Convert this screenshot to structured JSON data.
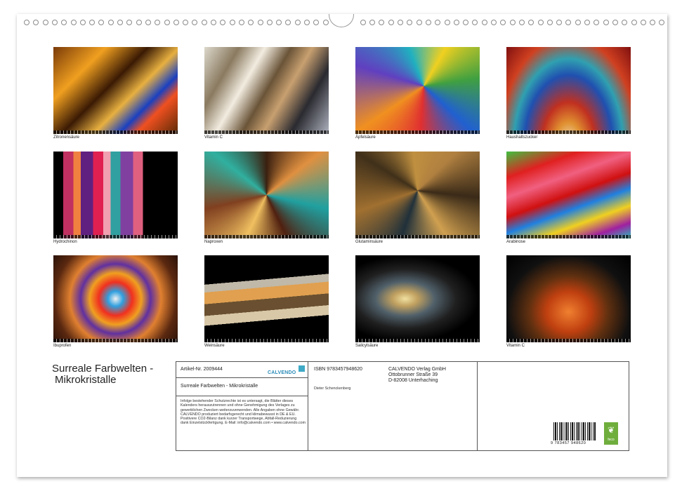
{
  "calendar": {
    "title_line1": "Surreale Farbwelten -",
    "title_line2": "Mikrokristalle"
  },
  "tiles": [
    {
      "caption": "Zitronensäure"
    },
    {
      "caption": "Vitamin C"
    },
    {
      "caption": "Äpfelsäure"
    },
    {
      "caption": "Haushaltszucker"
    },
    {
      "caption": "Hydrochinon"
    },
    {
      "caption": "Naproxen"
    },
    {
      "caption": "Glutaminsäure"
    },
    {
      "caption": "Arabinose"
    },
    {
      "caption": "Ibuprofen"
    },
    {
      "caption": "Weinsäure"
    },
    {
      "caption": "Salicylsäure"
    },
    {
      "caption": "Vitamin C"
    }
  ],
  "info": {
    "article": "Artikel-Nr. 2009444",
    "brand": "CALVENDO",
    "product_title": "Surreale Farbwelten - Mikrokristalle",
    "legal": "Infolge bestehender Schutzrechte ist es untersagt, die Blätter dieses Kalenders herauszutrennen und ohne Genehmigung des Verlages zu gewerblichen Zwecken weiterzuverwenden. Alle Angaben ohne Gewähr. CALVENDO produziert bedarfsgerecht und klimabewusst in DE & EU. Positivere CO2-Bilanz dank kurzer Transportwege, Abfall-Reduzierung dank Einzelstückfertigung. E-Mail: info@calvendo.com • www.calvendo.com",
    "isbn": "ISBN 9783457948620",
    "author": "Dieter Schenckenberg",
    "publisher_line1": "CALVENDO Verlag GmbH",
    "publisher_line2": "Ottobrunner Straße 39",
    "publisher_line3": "D-82008 Unterhaching",
    "barcode_number": "9 783457 948620",
    "eco_label": "feco"
  }
}
